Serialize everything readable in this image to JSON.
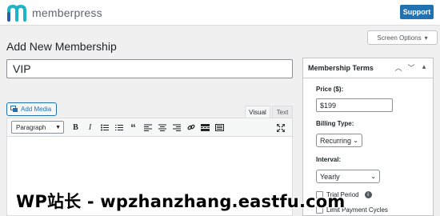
{
  "app": {
    "brand": "memberpress",
    "support_label": "Support",
    "brand_color": "#2271b1"
  },
  "screen_options": {
    "label": "Screen Options",
    "icon": "caret-down-icon"
  },
  "page": {
    "title": "Add New Membership"
  },
  "title_field": {
    "value": "VIP"
  },
  "editor": {
    "add_media_label": "Add Media",
    "tabs": [
      {
        "label": "Visual",
        "active": true
      },
      {
        "label": "Text",
        "active": false
      }
    ],
    "format_select": "Paragraph",
    "toolbar_icons": [
      "bold-icon",
      "italic-icon",
      "bullet-list-icon",
      "numbered-list-icon",
      "blockquote-icon",
      "align-left-icon",
      "align-center-icon",
      "align-right-icon",
      "link-icon",
      "read-more-icon",
      "toolbar-toggle-icon",
      "fullscreen-icon"
    ]
  },
  "membership_terms": {
    "title": "Membership Terms",
    "price_label": "Price ($):",
    "price_value": "$199",
    "billing_label": "Billing Type:",
    "billing_value": "Recurring",
    "interval_label": "Interval:",
    "interval_value": "Yearly",
    "trial_label": "Trial Period",
    "limit_label": "Limit Payment Cycles"
  },
  "watermark": {
    "text": "WP站长 - wpzhanzhang.eastfu.com"
  }
}
